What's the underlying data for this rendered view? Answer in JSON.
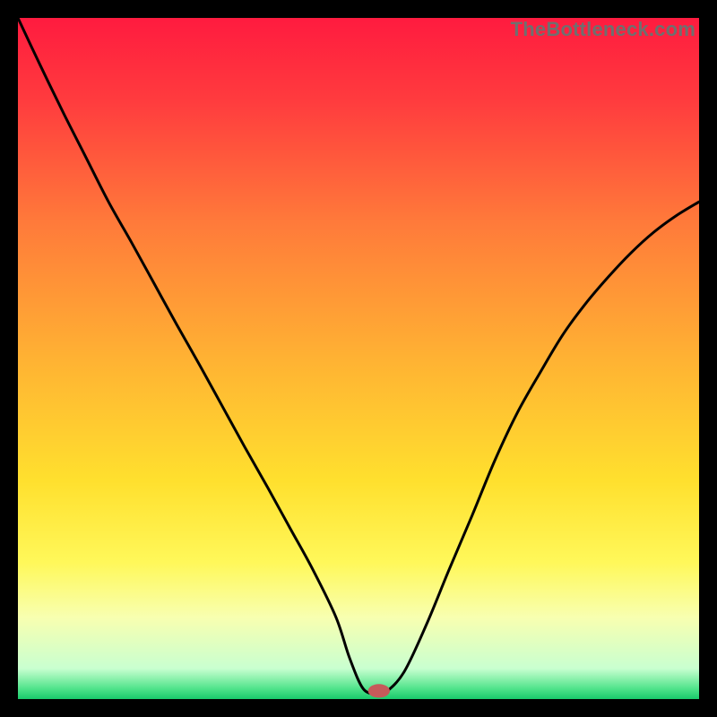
{
  "watermark": "TheBottleneck.com",
  "chart_data": {
    "type": "line",
    "title": "",
    "xlabel": "",
    "ylabel": "",
    "xlim": [
      0,
      100
    ],
    "ylim": [
      0,
      100
    ],
    "gradient_stops": [
      {
        "offset": 0.0,
        "color": "#ff1b3f"
      },
      {
        "offset": 0.12,
        "color": "#ff3b3e"
      },
      {
        "offset": 0.3,
        "color": "#ff7a3a"
      },
      {
        "offset": 0.5,
        "color": "#ffb233"
      },
      {
        "offset": 0.68,
        "color": "#ffe02e"
      },
      {
        "offset": 0.8,
        "color": "#fff85a"
      },
      {
        "offset": 0.88,
        "color": "#f8ffb0"
      },
      {
        "offset": 0.955,
        "color": "#c9ffd0"
      },
      {
        "offset": 0.985,
        "color": "#4fe38a"
      },
      {
        "offset": 1.0,
        "color": "#19c96b"
      }
    ],
    "series": [
      {
        "name": "bottleneck-curve",
        "x": [
          0.0,
          3.3,
          6.7,
          10.0,
          13.3,
          16.7,
          20.0,
          23.3,
          26.7,
          30.0,
          33.3,
          36.7,
          40.0,
          43.3,
          46.7,
          48.7,
          50.7,
          52.7,
          54.0,
          56.7,
          60.0,
          63.3,
          66.7,
          70.0,
          73.3,
          76.7,
          80.0,
          83.3,
          86.7,
          90.0,
          93.3,
          96.7,
          100.0
        ],
        "y": [
          100.0,
          93.0,
          86.0,
          79.5,
          73.0,
          67.0,
          61.0,
          55.0,
          49.0,
          43.0,
          37.0,
          31.0,
          25.0,
          19.0,
          12.0,
          6.0,
          1.5,
          0.8,
          1.0,
          4.0,
          11.0,
          19.0,
          27.0,
          35.0,
          42.0,
          48.0,
          53.5,
          58.0,
          62.0,
          65.5,
          68.5,
          71.0,
          73.0
        ]
      }
    ],
    "marker": {
      "x": 53.0,
      "y": 1.2,
      "rx": 1.6,
      "ry": 1.0,
      "color": "#c65a5a"
    }
  }
}
